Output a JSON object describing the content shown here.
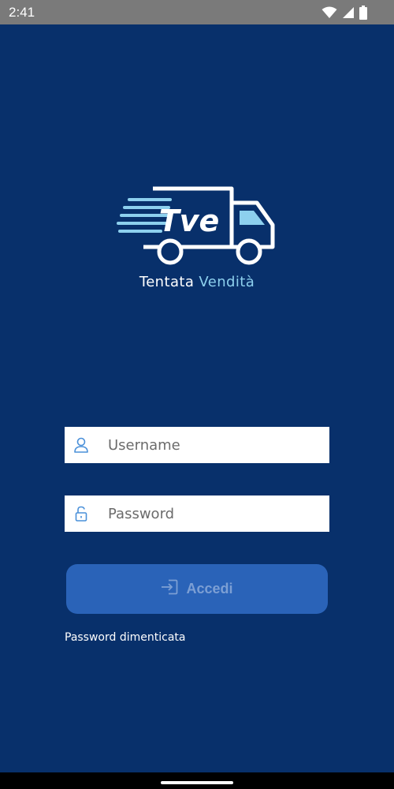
{
  "status_bar": {
    "time": "2:41",
    "icons": [
      "wifi-icon",
      "signal-icon",
      "battery-icon"
    ]
  },
  "brand": {
    "logo_icon": "delivery-truck-logo-icon",
    "logo_text": "Tve",
    "name_part1": "Tentata",
    "name_part2": "Vendità"
  },
  "form": {
    "username": {
      "icon": "user-icon",
      "placeholder": "Username",
      "value": ""
    },
    "password": {
      "icon": "lock-open-icon",
      "placeholder": "Password",
      "value": ""
    },
    "login_button": {
      "icon": "login-icon",
      "label": "Accedi"
    },
    "forgot_link": "Password dimenticata"
  },
  "colors": {
    "background": "#08306b",
    "accent_light": "#8dd0ee",
    "button": "#2a63b8",
    "button_text_disabled": "#7c9fd4",
    "field_icon": "#4a90d9"
  }
}
